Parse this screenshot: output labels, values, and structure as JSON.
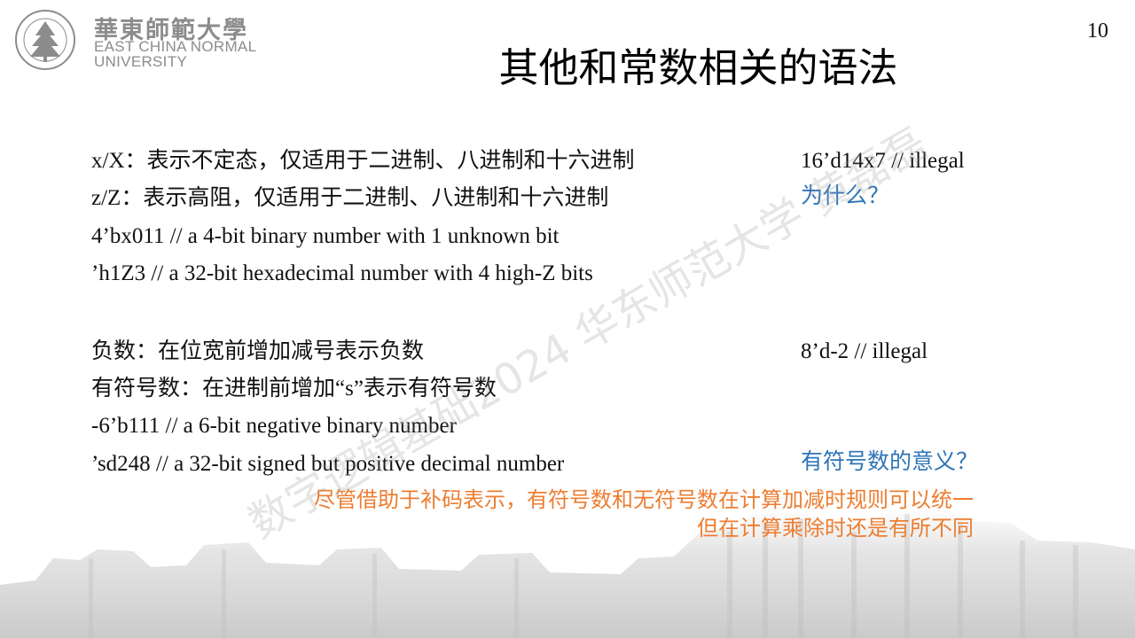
{
  "logo": {
    "cn": "華東師範大學",
    "en_line1": "EAST CHINA NORMAL",
    "en_line2": "UNIVERSITY"
  },
  "page_number": "10",
  "title": "其他和常数相关的语法",
  "lines": {
    "xX": "x/X：表示不定态，仅适用于二进制、八进制和十六进制",
    "zZ": "z/Z：表示高阻，仅适用于二进制、八进制和十六进制",
    "ex1": "4’bx011    // a 4-bit binary number with 1 unknown bit",
    "ex2": "’h1Z3    // a 32-bit hexadecimal number with 4 high-Z bits",
    "neg": "负数：在位宽前增加减号表示负数",
    "signed": "有符号数：在进制前增加“s”表示有符号数",
    "ex3": "-6’b111    // a 6-bit negative binary number",
    "ex4": "’sd248    // a 32-bit signed but positive decimal number"
  },
  "right": {
    "illegal1": "16’d14x7    // illegal",
    "why": "为什么？",
    "illegal2": "8’d-2    // illegal",
    "meaning": "有符号数的意义？"
  },
  "notes": {
    "line1": "尽管借助于补码表示，有符号数和无符号数在计算加减时规则可以统一",
    "line2": "但在计算乘除时还是有所不同"
  },
  "watermark": "数字逻辑基础2024 华东师范大学 黄磊磊",
  "colors": {
    "accent_blue": "#2e75b6",
    "accent_orange": "#ed7d31"
  }
}
